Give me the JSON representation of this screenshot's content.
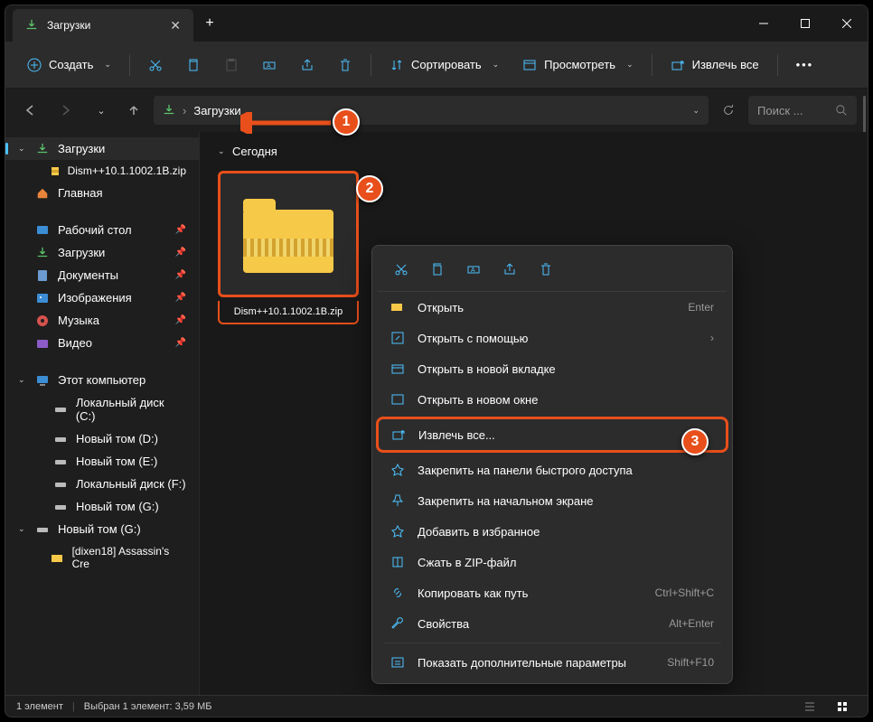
{
  "tab": {
    "title": "Загрузки"
  },
  "toolbar": {
    "create": "Создать",
    "sort": "Сортировать",
    "view": "Просмотреть",
    "extract": "Извлечь все"
  },
  "address": {
    "path": "Загрузки",
    "sep": "›"
  },
  "search": {
    "placeholder": "Поиск ..."
  },
  "sidebar": {
    "downloads": "Загрузки",
    "zipfile": "Dism++10.1.1002.1B.zip",
    "home": "Главная",
    "desktop": "Рабочий стол",
    "downloads2": "Загрузки",
    "documents": "Документы",
    "pictures": "Изображения",
    "music": "Музыка",
    "videos": "Видео",
    "thispc": "Этот компьютер",
    "local_c": "Локальный диск (C:)",
    "vol_d": "Новый том (D:)",
    "vol_e": "Новый том (E:)",
    "local_f": "Локальный диск (F:)",
    "vol_g": "Новый том (G:)",
    "vol_g2": "Новый том (G:)",
    "folder_g": "[dixen18] Assassin's Cre"
  },
  "content": {
    "group": "Сегодня",
    "filename": "Dism++10.1.1002.1B.zip"
  },
  "context": {
    "open": "Открыть",
    "open_short": "Enter",
    "open_with": "Открыть с помощью",
    "open_tab": "Открыть в новой вкладке",
    "open_win": "Открыть в новом окне",
    "extract": "Извлечь все...",
    "pin_quick": "Закрепить на панели быстрого доступа",
    "pin_start": "Закрепить на начальном экране",
    "favorite": "Добавить в избранное",
    "compress": "Сжать в ZIP-файл",
    "copy_path": "Копировать как путь",
    "copy_short": "Ctrl+Shift+C",
    "props": "Свойства",
    "props_short": "Alt+Enter",
    "more": "Показать дополнительные параметры",
    "more_short": "Shift+F10"
  },
  "status": {
    "count": "1 элемент",
    "selected": "Выбран 1 элемент: 3,59 МБ"
  },
  "badges": {
    "b1": "1",
    "b2": "2",
    "b3": "3"
  }
}
